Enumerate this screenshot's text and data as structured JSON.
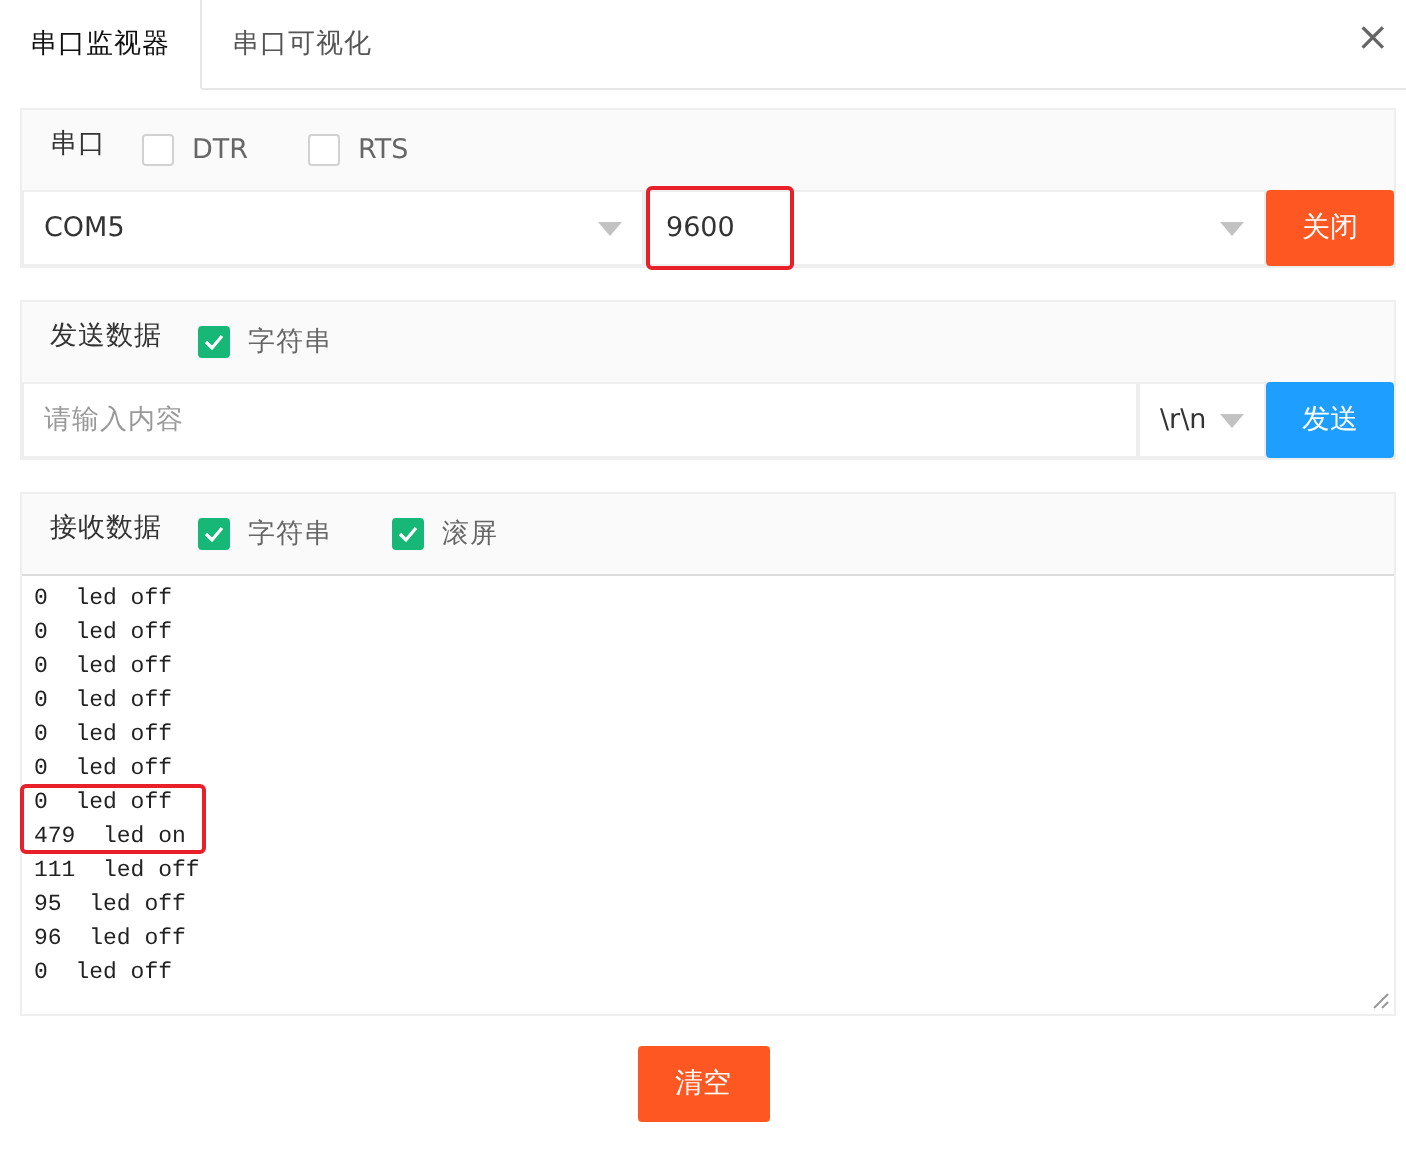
{
  "tabs": [
    {
      "label": "串口监视器",
      "selected": true
    },
    {
      "label": "串口可视化",
      "selected": false
    }
  ],
  "close": "×",
  "serial": {
    "title": "串口",
    "options": [
      {
        "label": "DTR",
        "checked": false
      },
      {
        "label": "RTS",
        "checked": false
      }
    ],
    "port": "COM5",
    "baud": "9600",
    "baud_highlighted": true,
    "button": "关闭"
  },
  "send": {
    "title": "发送数据",
    "options": [
      {
        "label": "字符串",
        "checked": true
      }
    ],
    "placeholder": "请输入内容",
    "ending": "\\r\\n",
    "button": "发送"
  },
  "receive": {
    "title": "接收数据",
    "options": [
      {
        "label": "字符串",
        "checked": true
      },
      {
        "label": "滚屏",
        "checked": true
      }
    ],
    "lines": [
      {
        "text": "0  led off",
        "highlighted": false
      },
      {
        "text": "0  led off",
        "highlighted": false
      },
      {
        "text": "0  led off",
        "highlighted": false
      },
      {
        "text": "0  led off",
        "highlighted": false
      },
      {
        "text": "0  led off",
        "highlighted": false
      },
      {
        "text": "0  led off",
        "highlighted": false
      },
      {
        "text": "0  led off",
        "highlighted": true
      },
      {
        "text": "479  led on",
        "highlighted": true
      },
      {
        "text": "111  led off",
        "highlighted": false
      },
      {
        "text": "95  led off",
        "highlighted": false
      },
      {
        "text": "96  led off",
        "highlighted": false
      },
      {
        "text": "0  led off",
        "highlighted": false
      }
    ]
  },
  "clear_button": "清空"
}
